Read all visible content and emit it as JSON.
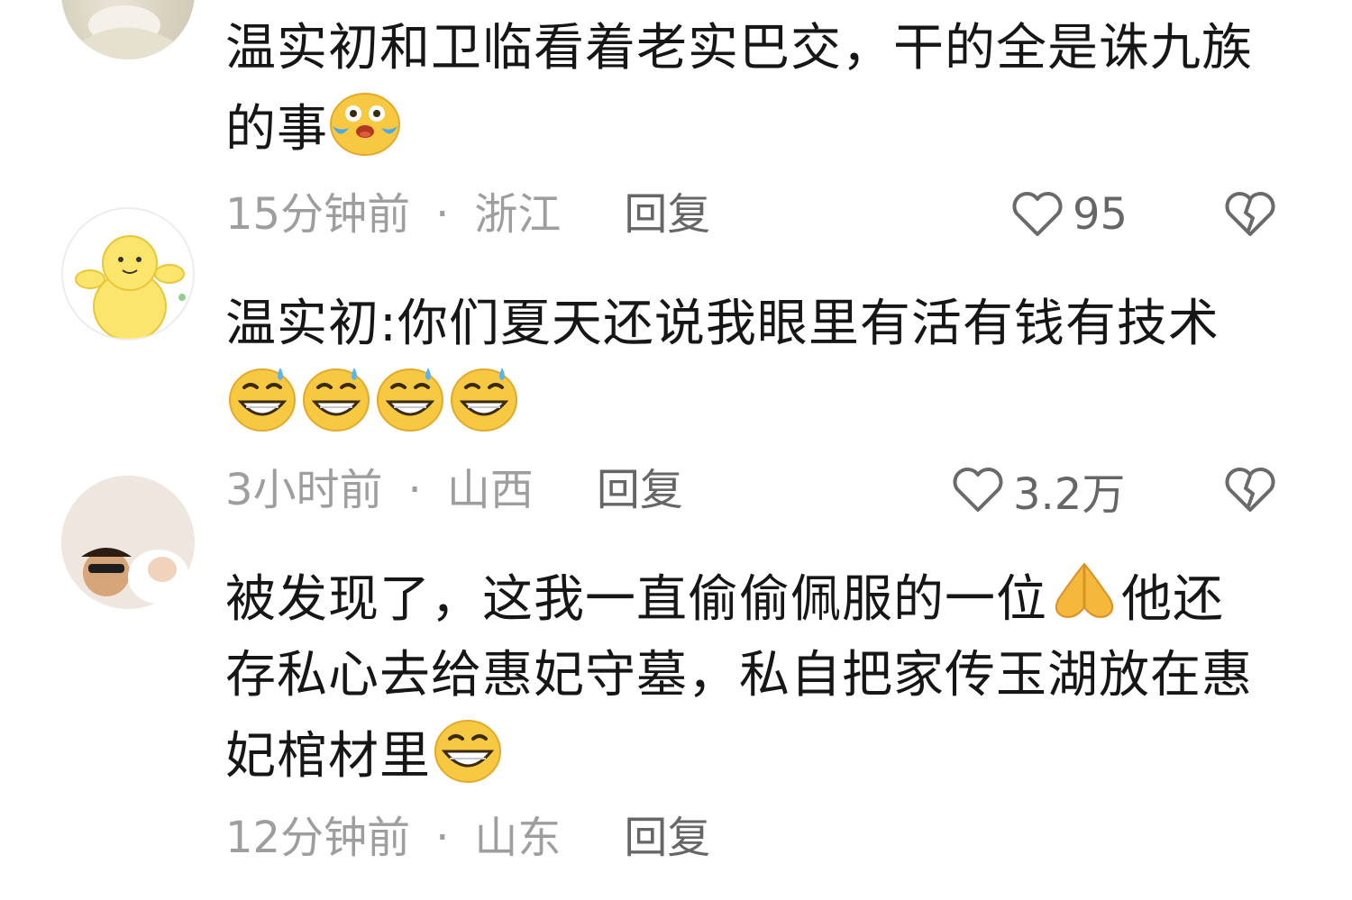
{
  "comments": [
    {
      "text": "温实初和卫临看着老实巴交，干的全是诛九族的事",
      "emojis": [
        "laugh-cry-emoji"
      ],
      "time": "15分钟前",
      "location": "浙江",
      "reply_label": "回复",
      "likes": "95"
    },
    {
      "text": "温实初:你们夏天还说我眼里有活有钱有技术",
      "emojis": [
        "sweat-grin-emoji",
        "sweat-grin-emoji",
        "sweat-grin-emoji",
        "sweat-grin-emoji"
      ],
      "time": "3小时前",
      "location": "山西",
      "reply_label": "回复",
      "likes": "3.2万"
    },
    {
      "text_part1": "被发现了，这我一直偷偷佩服的一位",
      "text_part2": "他还存私心去给惠妃守墓，私自把家传玉湖放在惠妃棺材里",
      "emojis": [
        "praying-hands-emoji",
        "big-grin-emoji"
      ],
      "time": "12分钟前",
      "location": "山东",
      "reply_label": "回复"
    }
  ],
  "separator": "·",
  "icons": {
    "like": "heart-outline-icon",
    "dislike": "broken-heart-icon"
  },
  "colors": {
    "text": "#161616",
    "meta": "#9e9e9e",
    "emoji_yellow": "#f7c842"
  }
}
